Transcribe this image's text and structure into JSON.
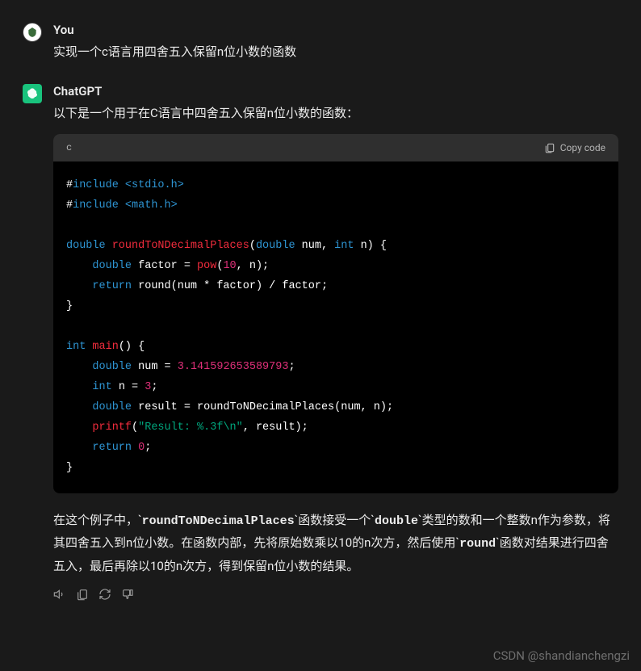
{
  "user": {
    "name": "You",
    "message": "实现一个c语言用四舍五入保留n位小数的函数"
  },
  "assistant": {
    "name": "ChatGPT",
    "intro": "以下是一个用于在C语言中四舍五入保留n位小数的函数：",
    "code": {
      "lang": "c",
      "copy_label": "Copy code",
      "lines": {
        "l1_hash": "#",
        "l1_include": "include",
        "l1_path": " <stdio.h>",
        "l2_hash": "#",
        "l2_include": "include",
        "l2_path": " <math.h>",
        "l4_double": "double",
        "l4_func": " roundToNDecimalPlaces",
        "l4_open": "(",
        "l4_double2": "double",
        "l4_args": " num, ",
        "l4_int": "int",
        "l4_n": " n) {",
        "l5_indent": "    ",
        "l5_double": "double",
        "l5_var": " factor = ",
        "l5_pow": "pow",
        "l5_open": "(",
        "l5_ten": "10",
        "l5_rest": ", n);",
        "l6_indent": "    ",
        "l6_return": "return",
        "l6_call": " round(num * factor) / factor;",
        "l7_close": "}",
        "l9_int": "int",
        "l9_main": " main",
        "l9_paren": "() {",
        "l10_indent": "    ",
        "l10_double": "double",
        "l10_num": " num = ",
        "l10_val": "3.141592653589793",
        "l10_semi": ";",
        "l11_indent": "    ",
        "l11_int": "int",
        "l11_n": " n = ",
        "l11_three": "3",
        "l11_semi": ";",
        "l12_indent": "    ",
        "l12_double": "double",
        "l12_rest": " result = roundToNDecimalPlaces(num, n);",
        "l13_indent": "    ",
        "l13_printf": "printf",
        "l13_open": "(",
        "l13_str": "\"Result: %.3f\\n\"",
        "l13_rest": ", result);",
        "l14_indent": "    ",
        "l14_return": "return",
        "l14_sp": " ",
        "l14_zero": "0",
        "l14_semi": ";",
        "l15_close": "}"
      }
    },
    "description": {
      "p1_a": "在这个例子中，`",
      "p1_code1": "roundToNDecimalPlaces",
      "p1_b": "`函数接受一个`",
      "p1_code2": "double",
      "p1_c": "`类型的数和一个整数n作为参数，将其四舍五入到n位小数。在函数内部，先将原始数乘以10的n次方，然后使用`",
      "p1_code3": "round",
      "p1_d": "`函数对结果进行四舍五入，最后再除以10的n次方，得到保留n位小数的结果。"
    }
  },
  "watermark": "CSDN @shandianchengzi"
}
